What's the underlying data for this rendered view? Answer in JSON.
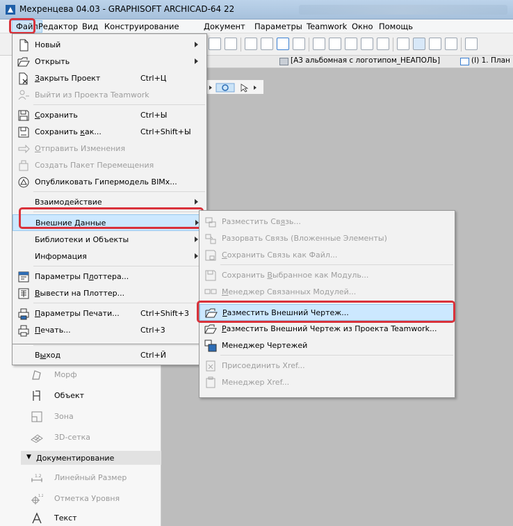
{
  "window": {
    "title": "Мехренцева 04.03 - GRAPHISOFT ARCHICAD-64 22"
  },
  "menubar": {
    "items": [
      "Файл",
      "Редактор",
      "Вид",
      "Конструирование",
      "Документ",
      "Параметры",
      "Teamwork",
      "Окно",
      "Помощь"
    ]
  },
  "tabs": [
    {
      "label": "[А3 альбомная с логотипом_НЕАПОЛЬ]"
    },
    {
      "label": "(I) 1. План"
    }
  ],
  "file_menu": {
    "items": [
      {
        "label": "Новый",
        "shortcut": "",
        "icon": "new-file-icon",
        "submenu": true,
        "enabled": true
      },
      {
        "label": "Открыть",
        "shortcut": "",
        "icon": "open-folder-icon",
        "submenu": true,
        "enabled": true
      },
      {
        "label": "Закрыть Проект",
        "shortcut": "Ctrl+Ц",
        "icon": "close-project-icon",
        "submenu": false,
        "enabled": true
      },
      {
        "label": "Выйти из Проекта Teamwork",
        "shortcut": "",
        "icon": "teamwork-leave-icon",
        "submenu": false,
        "enabled": false
      },
      {
        "label": "Сохранить",
        "shortcut": "Ctrl+Ы",
        "icon": "save-icon",
        "submenu": false,
        "enabled": true
      },
      {
        "label": "Сохранить как...",
        "shortcut": "Ctrl+Shift+Ы",
        "icon": "save-as-icon",
        "submenu": false,
        "enabled": true
      },
      {
        "label": "Отправить Изменения",
        "shortcut": "",
        "icon": "send-changes-icon",
        "submenu": false,
        "enabled": false
      },
      {
        "label": "Создать Пакет Перемещения",
        "shortcut": "",
        "icon": "package-icon",
        "submenu": false,
        "enabled": false
      },
      {
        "label": "Опубликовать Гипермодель BIMx...",
        "shortcut": "",
        "icon": "bimx-icon",
        "submenu": false,
        "enabled": true
      },
      {
        "label": "Взаимодействие",
        "shortcut": "",
        "icon": "",
        "submenu": true,
        "enabled": true
      },
      {
        "label": "Внешние Данные",
        "shortcut": "",
        "icon": "",
        "submenu": true,
        "enabled": true,
        "highlighted": true
      },
      {
        "label": "Библиотеки и Объекты",
        "shortcut": "",
        "icon": "",
        "submenu": true,
        "enabled": true
      },
      {
        "label": "Информация",
        "shortcut": "",
        "icon": "",
        "submenu": true,
        "enabled": true
      },
      {
        "label": "Параметры Плоттера...",
        "shortcut": "",
        "icon": "plotter-setup-icon",
        "submenu": false,
        "enabled": true
      },
      {
        "label": "Вывести на Плоттер...",
        "shortcut": "",
        "icon": "plot-icon",
        "submenu": false,
        "enabled": true
      },
      {
        "label": "Параметры Печати...",
        "shortcut": "Ctrl+Shift+3",
        "icon": "print-setup-icon",
        "submenu": false,
        "enabled": true
      },
      {
        "label": "Печать...",
        "shortcut": "Ctrl+3",
        "icon": "print-icon",
        "submenu": false,
        "enabled": true
      },
      {
        "label": "Выход",
        "shortcut": "Ctrl+Й",
        "icon": "",
        "submenu": false,
        "enabled": true
      }
    ]
  },
  "external_data_submenu": {
    "items": [
      {
        "label": "Разместить Связь...",
        "icon": "place-link-icon",
        "enabled": false
      },
      {
        "label": "Разорвать Связь (Вложенные Элементы)",
        "icon": "break-link-icon",
        "enabled": false
      },
      {
        "label": "Сохранить Связь как Файл...",
        "icon": "save-link-icon",
        "enabled": false
      },
      {
        "label": "Сохранить Выбранное как Модуль...",
        "icon": "save-module-icon",
        "enabled": false
      },
      {
        "label": "Менеджер Связанных Модулей...",
        "icon": "module-manager-icon",
        "enabled": false
      },
      {
        "label": "Разместить Внешний Чертеж...",
        "icon": "place-drawing-icon",
        "enabled": true,
        "highlighted": true
      },
      {
        "label": "Разместить Внешний Чертеж из Проекта Teamwork...",
        "icon": "place-drawing-teamwork-icon",
        "enabled": true
      },
      {
        "label": "Менеджер Чертежей",
        "icon": "drawing-manager-icon",
        "enabled": true
      },
      {
        "label": "Присоединить Xref...",
        "icon": "attach-xref-icon",
        "enabled": false
      },
      {
        "label": "Менеджер Xref...",
        "icon": "xref-manager-icon",
        "enabled": false
      }
    ]
  },
  "toolbox": {
    "items": [
      {
        "label": "Морф",
        "icon": "morph-icon",
        "enabled": false
      },
      {
        "label": "Объект",
        "icon": "object-icon",
        "enabled": true
      },
      {
        "label": "Зона",
        "icon": "zone-icon",
        "enabled": false
      },
      {
        "label": "3D-сетка",
        "icon": "mesh-icon",
        "enabled": false
      }
    ],
    "section": "Документирование",
    "doc_items": [
      {
        "label": "Линейный Размер",
        "icon": "dimension-icon",
        "enabled": false
      },
      {
        "label": "Отметка Уровня",
        "icon": "level-icon",
        "enabled": false
      },
      {
        "label": "Текст",
        "icon": "text-icon",
        "enabled": true
      }
    ]
  }
}
